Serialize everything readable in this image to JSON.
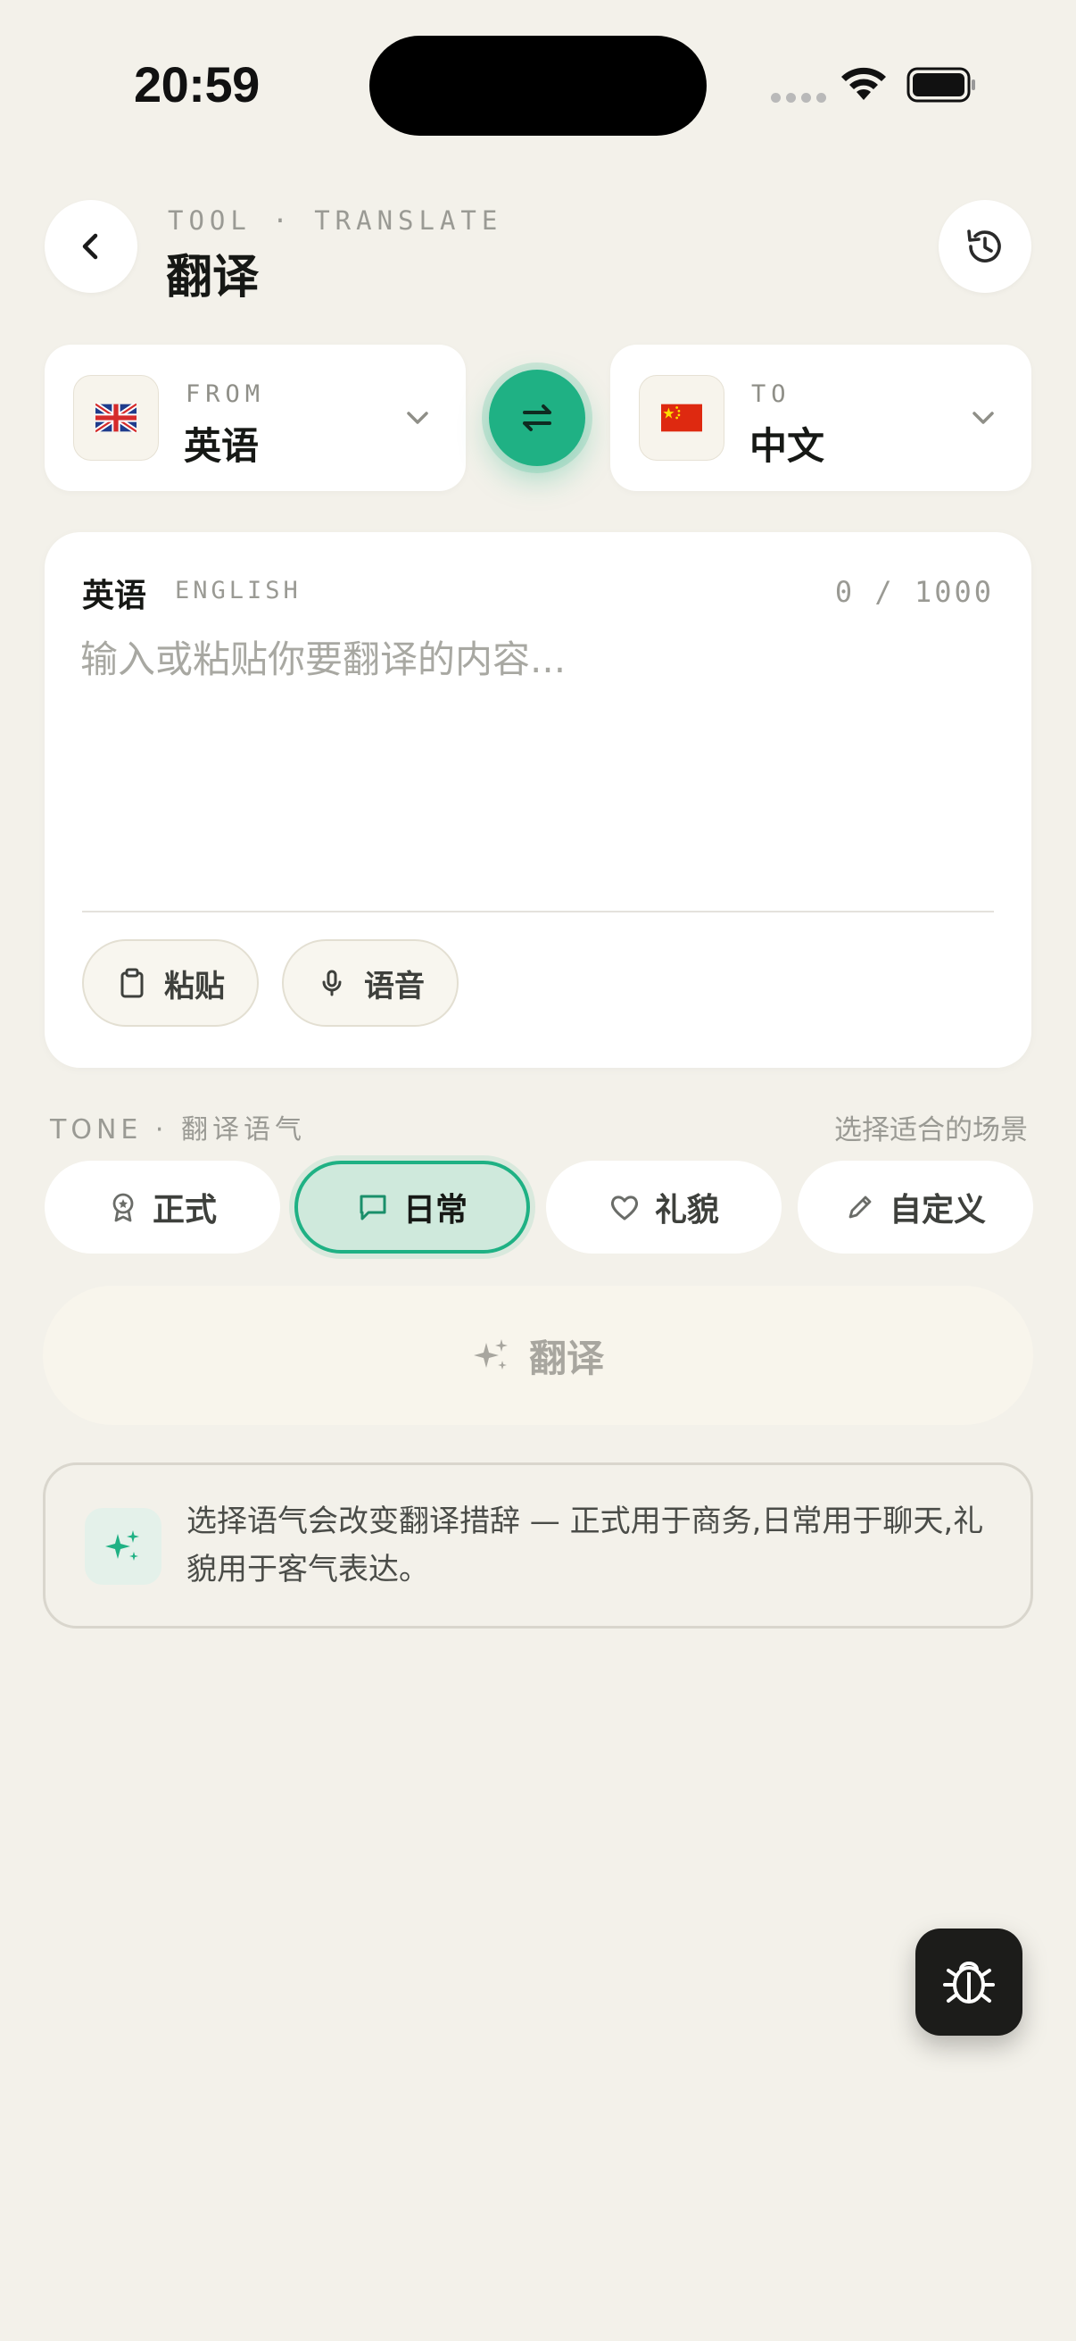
{
  "status_bar": {
    "time": "20:59"
  },
  "header": {
    "eyebrow": "TOOL · TRANSLATE",
    "title": "翻译"
  },
  "languages": {
    "from": {
      "label": "FROM",
      "name": "英语",
      "flag": "🇬🇧"
    },
    "to": {
      "label": "TO",
      "name": "中文",
      "flag": "🇨🇳"
    }
  },
  "input": {
    "language": "英语",
    "language_en": "ENGLISH",
    "count": "0 / 1000",
    "placeholder": "输入或粘贴你要翻译的内容..."
  },
  "actions": {
    "paste": "粘贴",
    "voice": "语音"
  },
  "tone": {
    "label": "TONE · 翻译语气",
    "hint": "选择适合的场景",
    "options": [
      {
        "label": "正式",
        "icon": "award-icon"
      },
      {
        "label": "日常",
        "icon": "chat-bubble-icon",
        "selected": true
      },
      {
        "label": "礼貌",
        "icon": "heart-icon"
      },
      {
        "label": "自定义",
        "icon": "pencil-icon"
      }
    ]
  },
  "translate_button": {
    "label": "翻译"
  },
  "tip": {
    "text": "选择语气会改变翻译措辞 — 正式用于商务,日常用于聊天,礼貌用于客气表达。"
  },
  "colors": {
    "accent": "#1fb184",
    "background": "#f3f1ea",
    "selected_bg": "#cfe9dc"
  }
}
